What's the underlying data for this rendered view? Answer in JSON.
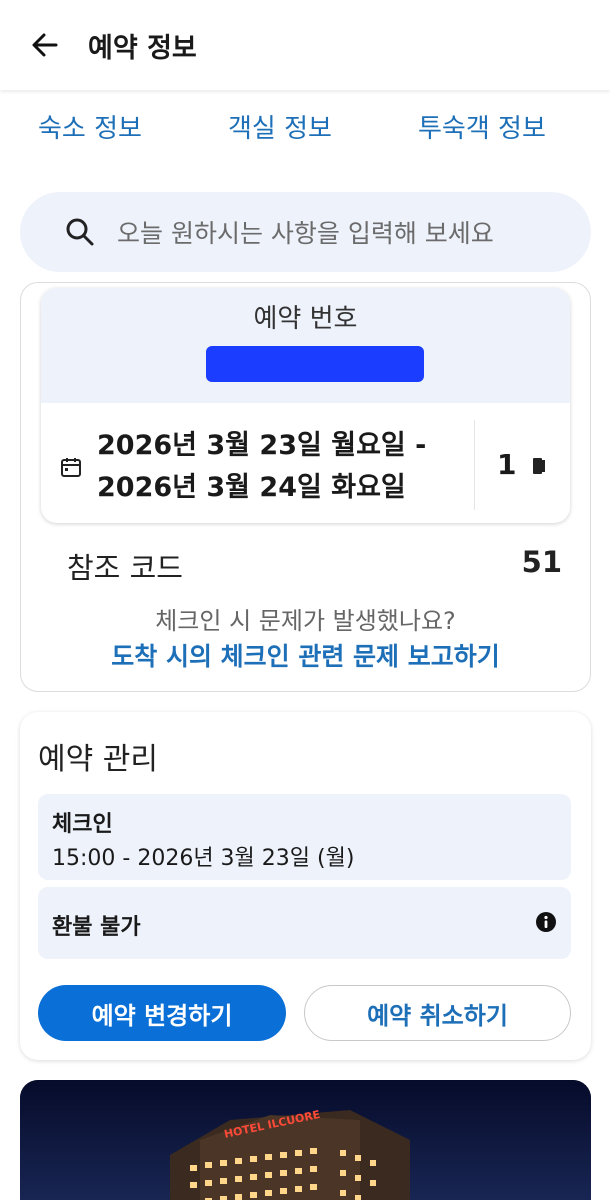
{
  "header": {
    "title": "예약 정보"
  },
  "tabs": [
    {
      "label": "숙소 정보"
    },
    {
      "label": "객실 정보"
    },
    {
      "label": "투숙객 정보"
    }
  ],
  "search": {
    "placeholder": "오늘 원하시는 사항을 입력해 보세요"
  },
  "booking": {
    "reservation_label": "예약 번호",
    "date_start": "2026년 3월 23일 월요일 -",
    "date_end": "2026년 3월 24일 화요일",
    "nights": "1",
    "reference_label": "참조 코드",
    "reference_value": "51",
    "problem_text": "체크인 시 문제가 발생했나요?",
    "problem_link": "도착 시의 체크인 관련 문제 보고하기"
  },
  "manage": {
    "title": "예약 관리",
    "checkin_label": "체크인",
    "checkin_time": "15:00 - 2026년 3월 23일 (월)",
    "refund_label": "환불 불가",
    "change_button": "예약 변경하기",
    "cancel_button": "예약 취소하기"
  },
  "hotel": {
    "sign": "HOTEL ILCUORE"
  },
  "colors": {
    "accent": "#0a6fd6",
    "link": "#1d6fb8",
    "panel": "#eef2fb",
    "redaction": "#1a3dff"
  },
  "icons": {
    "back": "arrow-left-icon",
    "search": "search-icon",
    "calendar": "calendar-icon",
    "nights": "moon-icon",
    "info": "info-icon"
  }
}
